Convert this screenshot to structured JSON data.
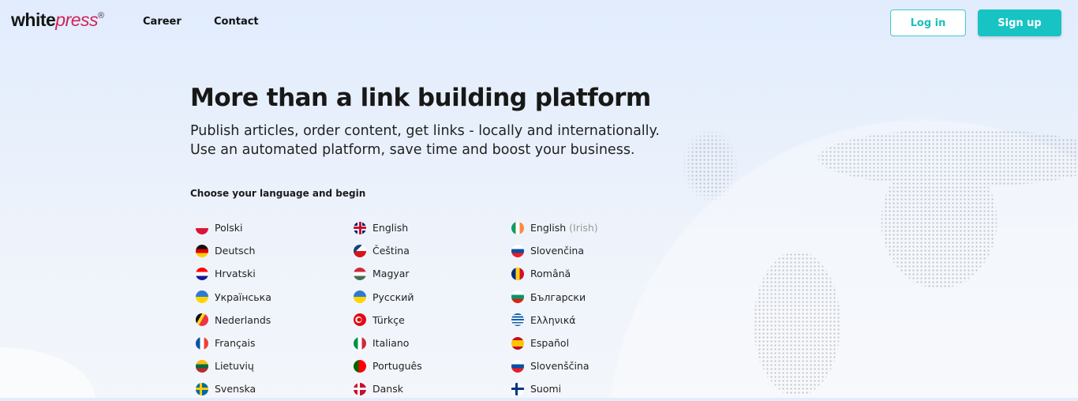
{
  "nav": {
    "logo_main": "white",
    "logo_accent": "press",
    "logo_mark": "®",
    "links": [
      "Career",
      "Contact"
    ],
    "login": "Log in",
    "signup": "Sign up"
  },
  "hero": {
    "title": "More than a link building platform",
    "subtitle": "Publish articles, order content, get links - locally and internationally. Use an automated platform, save time and boost your business.",
    "choose": "Choose your language and begin"
  },
  "languages": [
    {
      "label": "Polski",
      "flag": "pl"
    },
    {
      "label": "English",
      "flag": "gb"
    },
    {
      "label": "English",
      "note": "(Irish)",
      "flag": "ie"
    },
    {
      "label": "Deutsch",
      "flag": "de"
    },
    {
      "label": "Čeština",
      "flag": "cz"
    },
    {
      "label": "Slovenčina",
      "flag": "sk"
    },
    {
      "label": "Hrvatski",
      "flag": "hr"
    },
    {
      "label": "Magyar",
      "flag": "hu"
    },
    {
      "label": "Română",
      "flag": "ro"
    },
    {
      "label": "Українська",
      "flag": "ua"
    },
    {
      "label": "Русский",
      "flag": "ua"
    },
    {
      "label": "Български",
      "flag": "bg"
    },
    {
      "label": "Nederlands",
      "flag": "be"
    },
    {
      "label": "Türkçe",
      "flag": "tr"
    },
    {
      "label": "Ελληνικά",
      "flag": "gr"
    },
    {
      "label": "Français",
      "flag": "fr"
    },
    {
      "label": "Italiano",
      "flag": "it"
    },
    {
      "label": "Español",
      "flag": "es"
    },
    {
      "label": "Lietuvių",
      "flag": "lt"
    },
    {
      "label": "Português",
      "flag": "pt"
    },
    {
      "label": "Slovenščina",
      "flag": "si"
    },
    {
      "label": "Svenska",
      "flag": "se"
    },
    {
      "label": "Dansk",
      "flag": "dk"
    },
    {
      "label": "Suomi",
      "flag": "fi"
    }
  ]
}
